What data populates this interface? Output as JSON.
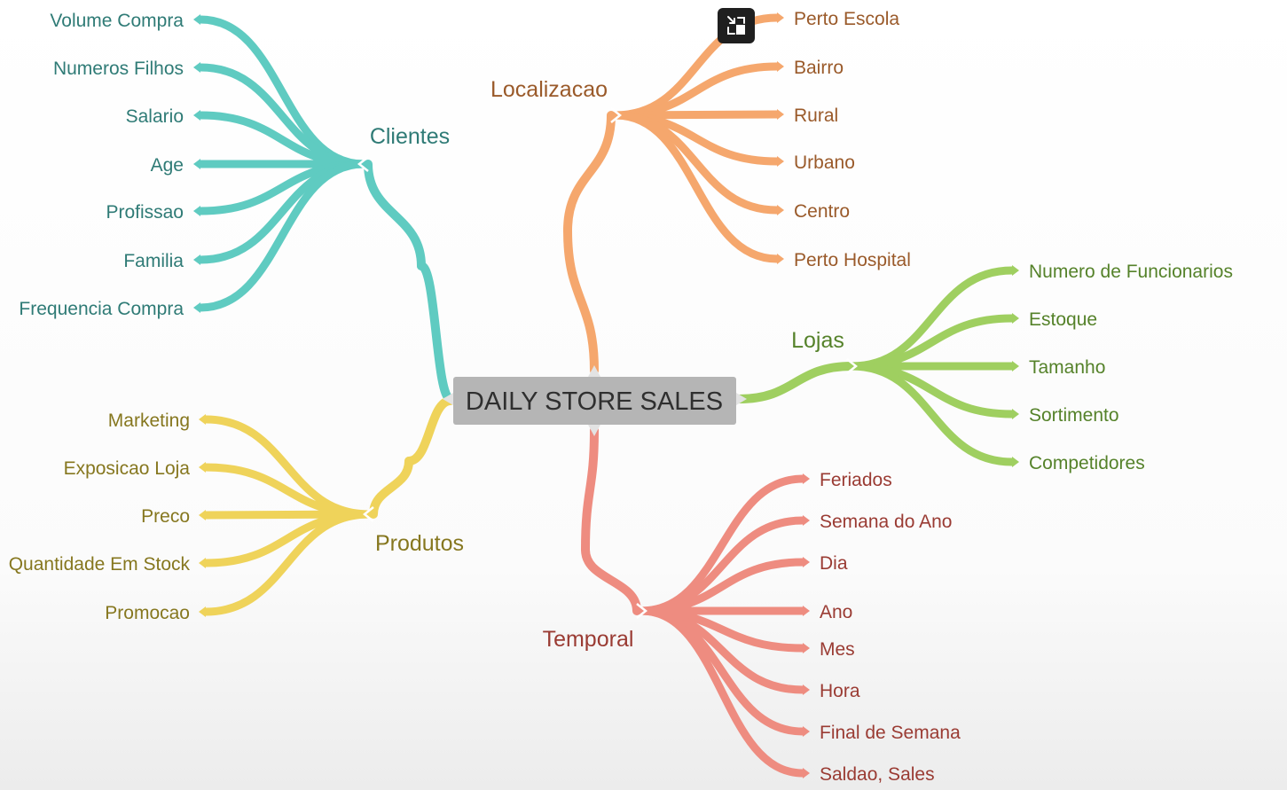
{
  "colors": {
    "clientes": "#5fcbc1",
    "clientes_text": "#2f7b76",
    "produtos": "#efd35a",
    "produtos_text": "#86771f",
    "localizacao": "#f5a76d",
    "localizacao_text": "#9a5a2a",
    "lojas": "#9fcf60",
    "lojas_text": "#55822a",
    "temporal": "#ee8c80",
    "temporal_text": "#9a3b33",
    "root_bg": "#b5b5b5"
  },
  "mindmap": {
    "root": "DAILY STORE SALES",
    "clientes": {
      "label": "Clientes",
      "items": [
        "Volume Compra",
        "Numeros Filhos",
        "Salario",
        "Age",
        "Profissao",
        "Familia",
        "Frequencia Compra"
      ]
    },
    "produtos": {
      "label": "Produtos",
      "items": [
        "Marketing",
        "Exposicao Loja",
        "Preco",
        "Quantidade Em Stock",
        "Promocao"
      ]
    },
    "localizacao": {
      "label": "Localizacao",
      "items": [
        "Perto Escola",
        "Bairro",
        "Rural",
        "Urbano",
        "Centro",
        "Perto Hospital"
      ]
    },
    "lojas": {
      "label": "Lojas",
      "items": [
        "Numero de Funcionarios",
        "Estoque",
        "Tamanho",
        "Sortimento",
        "Competidores"
      ]
    },
    "temporal": {
      "label": "Temporal",
      "items": [
        "Feriados",
        "Semana do Ano",
        "Dia",
        "Ano",
        "Mes",
        "Hora",
        "Final de Semana",
        "Saldao, Sales"
      ]
    }
  },
  "overlay": {
    "icon": "exit-fullscreen-icon"
  }
}
